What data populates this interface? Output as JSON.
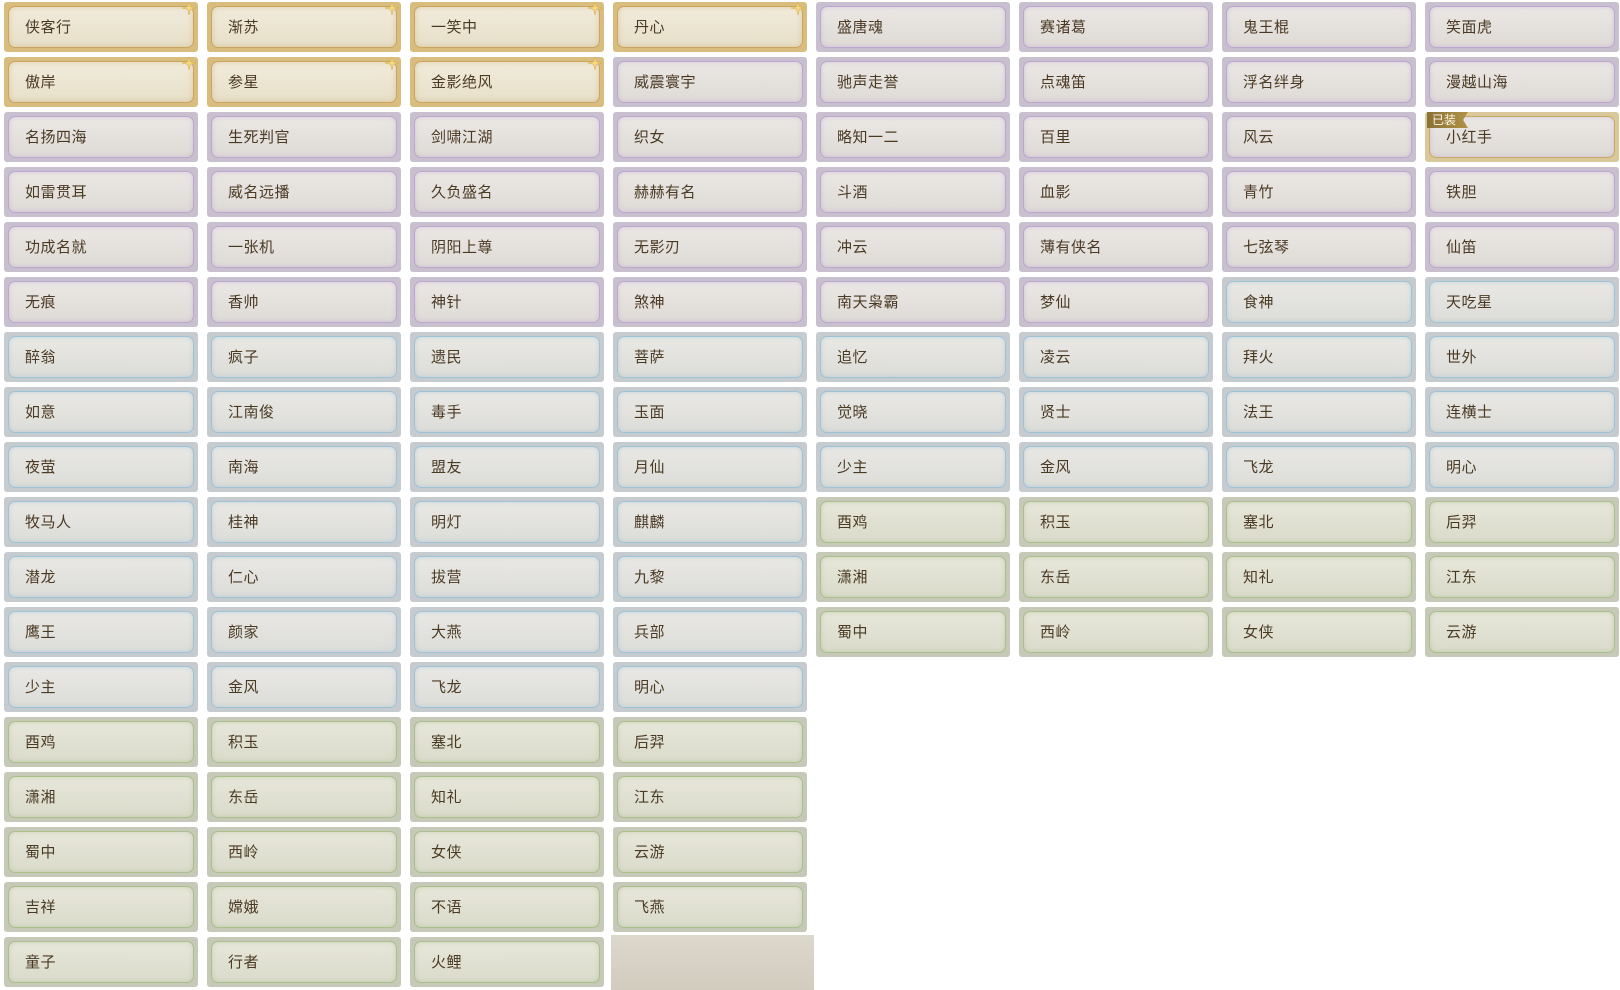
{
  "equipped_badge": "已装",
  "colors": {
    "gold_border": "#c9a660",
    "purple_border": "#bba7cf",
    "blue_border": "#9fc3d6",
    "green_border": "#a9bf8c",
    "label_text": "#4a3a24"
  },
  "titles": [
    {
      "name": "侠客行",
      "rarity": "gold",
      "sparkle": true,
      "equipped": false
    },
    {
      "name": "渐苏",
      "rarity": "gold",
      "sparkle": true,
      "equipped": false
    },
    {
      "name": "一笑中",
      "rarity": "gold",
      "sparkle": true,
      "equipped": false
    },
    {
      "name": "丹心",
      "rarity": "gold",
      "sparkle": true,
      "equipped": false
    },
    {
      "name": "盛唐魂",
      "rarity": "purple",
      "sparkle": false,
      "equipped": false
    },
    {
      "name": "赛诸葛",
      "rarity": "purple",
      "sparkle": false,
      "equipped": false
    },
    {
      "name": "鬼王棍",
      "rarity": "purple",
      "sparkle": false,
      "equipped": false
    },
    {
      "name": "笑面虎",
      "rarity": "purple",
      "sparkle": false,
      "equipped": false
    },
    {
      "name": "傲岸",
      "rarity": "gold",
      "sparkle": true,
      "equipped": false
    },
    {
      "name": "参星",
      "rarity": "gold",
      "sparkle": true,
      "equipped": false
    },
    {
      "name": "金影绝风",
      "rarity": "gold",
      "sparkle": true,
      "equipped": false
    },
    {
      "name": "威震寰宇",
      "rarity": "purple",
      "sparkle": false,
      "equipped": false
    },
    {
      "name": "驰声走誉",
      "rarity": "purple",
      "sparkle": false,
      "equipped": false
    },
    {
      "name": "点魂笛",
      "rarity": "purple",
      "sparkle": false,
      "equipped": false
    },
    {
      "name": "浮名绊身",
      "rarity": "purple",
      "sparkle": false,
      "equipped": false
    },
    {
      "name": "漫越山海",
      "rarity": "purple",
      "sparkle": false,
      "equipped": false
    },
    {
      "name": "名扬四海",
      "rarity": "purple",
      "sparkle": false,
      "equipped": false
    },
    {
      "name": "生死判官",
      "rarity": "purple",
      "sparkle": false,
      "equipped": false
    },
    {
      "name": "剑啸江湖",
      "rarity": "purple",
      "sparkle": false,
      "equipped": false
    },
    {
      "name": "织女",
      "rarity": "purple",
      "sparkle": false,
      "equipped": false
    },
    {
      "name": "略知一二",
      "rarity": "purple",
      "sparkle": false,
      "equipped": false
    },
    {
      "name": "百里",
      "rarity": "purple",
      "sparkle": false,
      "equipped": false
    },
    {
      "name": "风云",
      "rarity": "purple",
      "sparkle": false,
      "equipped": false
    },
    {
      "name": "小红手",
      "rarity": "purple",
      "sparkle": false,
      "equipped": true
    },
    {
      "name": "如雷贯耳",
      "rarity": "purple",
      "sparkle": false,
      "equipped": false
    },
    {
      "name": "威名远播",
      "rarity": "purple",
      "sparkle": false,
      "equipped": false
    },
    {
      "name": "久负盛名",
      "rarity": "purple",
      "sparkle": false,
      "equipped": false
    },
    {
      "name": "赫赫有名",
      "rarity": "purple",
      "sparkle": false,
      "equipped": false
    },
    {
      "name": "斗酒",
      "rarity": "purple",
      "sparkle": false,
      "equipped": false
    },
    {
      "name": "血影",
      "rarity": "purple",
      "sparkle": false,
      "equipped": false
    },
    {
      "name": "青竹",
      "rarity": "purple",
      "sparkle": false,
      "equipped": false
    },
    {
      "name": "铁胆",
      "rarity": "purple",
      "sparkle": false,
      "equipped": false
    },
    {
      "name": "功成名就",
      "rarity": "purple",
      "sparkle": false,
      "equipped": false
    },
    {
      "name": "一张机",
      "rarity": "purple",
      "sparkle": false,
      "equipped": false
    },
    {
      "name": "阴阳上尊",
      "rarity": "purple",
      "sparkle": false,
      "equipped": false
    },
    {
      "name": "无影刃",
      "rarity": "purple",
      "sparkle": false,
      "equipped": false
    },
    {
      "name": "冲云",
      "rarity": "purple",
      "sparkle": false,
      "equipped": false
    },
    {
      "name": "薄有侠名",
      "rarity": "purple",
      "sparkle": false,
      "equipped": false
    },
    {
      "name": "七弦琴",
      "rarity": "purple",
      "sparkle": false,
      "equipped": false
    },
    {
      "name": "仙笛",
      "rarity": "purple",
      "sparkle": false,
      "equipped": false
    },
    {
      "name": "无痕",
      "rarity": "purple",
      "sparkle": false,
      "equipped": false
    },
    {
      "name": "香帅",
      "rarity": "purple",
      "sparkle": false,
      "equipped": false
    },
    {
      "name": "神针",
      "rarity": "purple",
      "sparkle": false,
      "equipped": false
    },
    {
      "name": "煞神",
      "rarity": "purple",
      "sparkle": false,
      "equipped": false
    },
    {
      "name": "南天枭霸",
      "rarity": "purple",
      "sparkle": false,
      "equipped": false
    },
    {
      "name": "梦仙",
      "rarity": "purple",
      "sparkle": false,
      "equipped": false
    },
    {
      "name": "食神",
      "rarity": "blue",
      "sparkle": false,
      "equipped": false
    },
    {
      "name": "天吃星",
      "rarity": "blue",
      "sparkle": false,
      "equipped": false
    },
    {
      "name": "醉翁",
      "rarity": "blue",
      "sparkle": false,
      "equipped": false
    },
    {
      "name": "疯子",
      "rarity": "blue",
      "sparkle": false,
      "equipped": false
    },
    {
      "name": "遗民",
      "rarity": "blue",
      "sparkle": false,
      "equipped": false
    },
    {
      "name": "菩萨",
      "rarity": "blue",
      "sparkle": false,
      "equipped": false
    },
    {
      "name": "追忆",
      "rarity": "blue",
      "sparkle": false,
      "equipped": false
    },
    {
      "name": "凌云",
      "rarity": "blue",
      "sparkle": false,
      "equipped": false
    },
    {
      "name": "拜火",
      "rarity": "blue",
      "sparkle": false,
      "equipped": false
    },
    {
      "name": "世外",
      "rarity": "blue",
      "sparkle": false,
      "equipped": false
    },
    {
      "name": "如意",
      "rarity": "blue",
      "sparkle": false,
      "equipped": false
    },
    {
      "name": "江南俊",
      "rarity": "blue",
      "sparkle": false,
      "equipped": false
    },
    {
      "name": "毒手",
      "rarity": "blue",
      "sparkle": false,
      "equipped": false
    },
    {
      "name": "玉面",
      "rarity": "blue",
      "sparkle": false,
      "equipped": false
    },
    {
      "name": "觉晓",
      "rarity": "blue",
      "sparkle": false,
      "equipped": false
    },
    {
      "name": "贤士",
      "rarity": "blue",
      "sparkle": false,
      "equipped": false
    },
    {
      "name": "法王",
      "rarity": "blue",
      "sparkle": false,
      "equipped": false
    },
    {
      "name": "连横士",
      "rarity": "blue",
      "sparkle": false,
      "equipped": false
    },
    {
      "name": "夜萤",
      "rarity": "blue",
      "sparkle": false,
      "equipped": false
    },
    {
      "name": "南海",
      "rarity": "blue",
      "sparkle": false,
      "equipped": false
    },
    {
      "name": "盟友",
      "rarity": "blue",
      "sparkle": false,
      "equipped": false
    },
    {
      "name": "月仙",
      "rarity": "blue",
      "sparkle": false,
      "equipped": false
    },
    {
      "name": "少主",
      "rarity": "blue",
      "sparkle": false,
      "equipped": false
    },
    {
      "name": "金风",
      "rarity": "blue",
      "sparkle": false,
      "equipped": false
    },
    {
      "name": "飞龙",
      "rarity": "blue",
      "sparkle": false,
      "equipped": false
    },
    {
      "name": "明心",
      "rarity": "blue",
      "sparkle": false,
      "equipped": false
    },
    {
      "name": "牧马人",
      "rarity": "blue",
      "sparkle": false,
      "equipped": false
    },
    {
      "name": "桂神",
      "rarity": "blue",
      "sparkle": false,
      "equipped": false
    },
    {
      "name": "明灯",
      "rarity": "blue",
      "sparkle": false,
      "equipped": false
    },
    {
      "name": "麒麟",
      "rarity": "blue",
      "sparkle": false,
      "equipped": false
    },
    {
      "name": "酉鸡",
      "rarity": "green",
      "sparkle": false,
      "equipped": false
    },
    {
      "name": "积玉",
      "rarity": "green",
      "sparkle": false,
      "equipped": false
    },
    {
      "name": "塞北",
      "rarity": "green",
      "sparkle": false,
      "equipped": false
    },
    {
      "name": "后羿",
      "rarity": "green",
      "sparkle": false,
      "equipped": false
    },
    {
      "name": "潜龙",
      "rarity": "blue",
      "sparkle": false,
      "equipped": false
    },
    {
      "name": "仁心",
      "rarity": "blue",
      "sparkle": false,
      "equipped": false
    },
    {
      "name": "拔营",
      "rarity": "blue",
      "sparkle": false,
      "equipped": false
    },
    {
      "name": "九黎",
      "rarity": "blue",
      "sparkle": false,
      "equipped": false
    },
    {
      "name": "潇湘",
      "rarity": "green",
      "sparkle": false,
      "equipped": false
    },
    {
      "name": "东岳",
      "rarity": "green",
      "sparkle": false,
      "equipped": false
    },
    {
      "name": "知礼",
      "rarity": "green",
      "sparkle": false,
      "equipped": false
    },
    {
      "name": "江东",
      "rarity": "green",
      "sparkle": false,
      "equipped": false
    },
    {
      "name": "鹰王",
      "rarity": "blue",
      "sparkle": false,
      "equipped": false
    },
    {
      "name": "颜家",
      "rarity": "blue",
      "sparkle": false,
      "equipped": false
    },
    {
      "name": "大燕",
      "rarity": "blue",
      "sparkle": false,
      "equipped": false
    },
    {
      "name": "兵部",
      "rarity": "blue",
      "sparkle": false,
      "equipped": false
    },
    {
      "name": "蜀中",
      "rarity": "green",
      "sparkle": false,
      "equipped": false
    },
    {
      "name": "西岭",
      "rarity": "green",
      "sparkle": false,
      "equipped": false
    },
    {
      "name": "女侠",
      "rarity": "green",
      "sparkle": false,
      "equipped": false
    },
    {
      "name": "云游",
      "rarity": "green",
      "sparkle": false,
      "equipped": false
    },
    {
      "name": "少主",
      "rarity": "blue",
      "sparkle": false,
      "equipped": false
    },
    {
      "name": "金风",
      "rarity": "blue",
      "sparkle": false,
      "equipped": false
    },
    {
      "name": "飞龙",
      "rarity": "blue",
      "sparkle": false,
      "equipped": false
    },
    {
      "name": "明心",
      "rarity": "blue",
      "sparkle": false,
      "equipped": false
    },
    {
      "name": "酉鸡",
      "rarity": "green",
      "sparkle": false,
      "equipped": false
    },
    {
      "name": "积玉",
      "rarity": "green",
      "sparkle": false,
      "equipped": false
    },
    {
      "name": "塞北",
      "rarity": "green",
      "sparkle": false,
      "equipped": false
    },
    {
      "name": "后羿",
      "rarity": "green",
      "sparkle": false,
      "equipped": false
    },
    {
      "name": "潇湘",
      "rarity": "green",
      "sparkle": false,
      "equipped": false
    },
    {
      "name": "东岳",
      "rarity": "green",
      "sparkle": false,
      "equipped": false
    },
    {
      "name": "知礼",
      "rarity": "green",
      "sparkle": false,
      "equipped": false
    },
    {
      "name": "江东",
      "rarity": "green",
      "sparkle": false,
      "equipped": false
    },
    {
      "name": "蜀中",
      "rarity": "green",
      "sparkle": false,
      "equipped": false
    },
    {
      "name": "西岭",
      "rarity": "green",
      "sparkle": false,
      "equipped": false
    },
    {
      "name": "女侠",
      "rarity": "green",
      "sparkle": false,
      "equipped": false
    },
    {
      "name": "云游",
      "rarity": "green",
      "sparkle": false,
      "equipped": false
    },
    {
      "name": "吉祥",
      "rarity": "green",
      "sparkle": false,
      "equipped": false
    },
    {
      "name": "嫦娥",
      "rarity": "green",
      "sparkle": false,
      "equipped": false
    },
    {
      "name": "不语",
      "rarity": "green",
      "sparkle": false,
      "equipped": false
    },
    {
      "name": "飞燕",
      "rarity": "green",
      "sparkle": false,
      "equipped": false
    },
    {
      "name": "童子",
      "rarity": "green",
      "sparkle": false,
      "equipped": false
    },
    {
      "name": "行者",
      "rarity": "green",
      "sparkle": false,
      "equipped": false
    },
    {
      "name": "火鲤",
      "rarity": "green",
      "sparkle": false,
      "equipped": false
    }
  ]
}
